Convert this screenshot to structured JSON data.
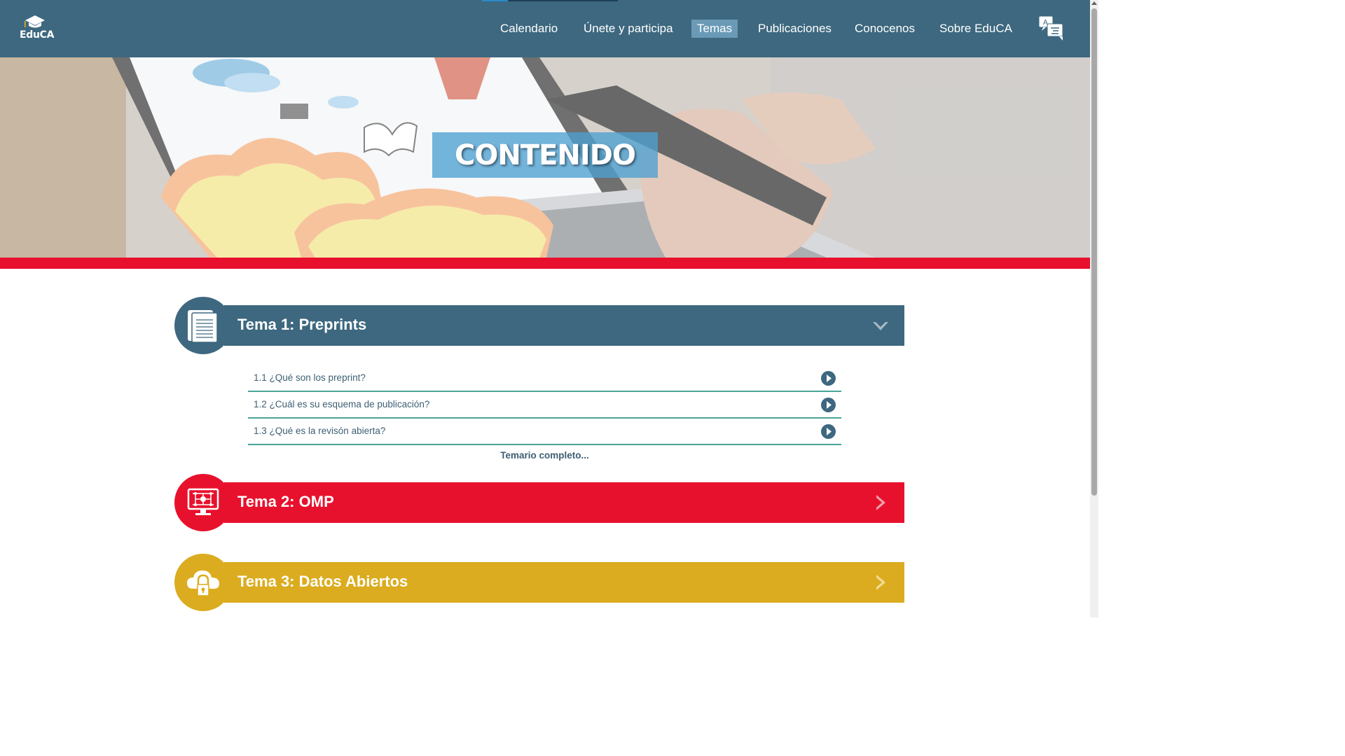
{
  "app": {
    "logo_text": "EduCA",
    "logo_icon": "graduation-cap-icon",
    "translate_icon": "translate-icon"
  },
  "nav": {
    "items": [
      {
        "label": "Calendario",
        "active": false
      },
      {
        "label": "Únete y participa",
        "active": false
      },
      {
        "label": "Temas",
        "active": true
      },
      {
        "label": "Publicaciones",
        "active": false
      },
      {
        "label": "Conocenos",
        "active": false
      },
      {
        "label": "Sobre EduCA",
        "active": false
      }
    ]
  },
  "hero": {
    "title": "CONTENIDO"
  },
  "topics": [
    {
      "title": "Tema 1: Preprints",
      "icon": "documents-icon",
      "color": "#3d687f",
      "expanded": true,
      "subitems": [
        {
          "label": "1.1 ¿Qué son los preprint?"
        },
        {
          "label": "1.2 ¿Cuál es su esquema de publicación?"
        },
        {
          "label": "1.3 ¿Qué es la revisón abierta?"
        }
      ],
      "more_link": "Temario completo..."
    },
    {
      "title": "Tema 2: OMP",
      "icon": "monitor-network-icon",
      "color": "#e8112d",
      "expanded": false
    },
    {
      "title": "Tema 3: Datos Abiertos",
      "icon": "cloud-lock-icon",
      "color": "#dbac1f",
      "expanded": false
    }
  ],
  "colors": {
    "navbar": "#3d687f",
    "accent_red": "#e8112d",
    "accent_yellow": "#dbac1f",
    "divider_green": "#4aa596"
  }
}
